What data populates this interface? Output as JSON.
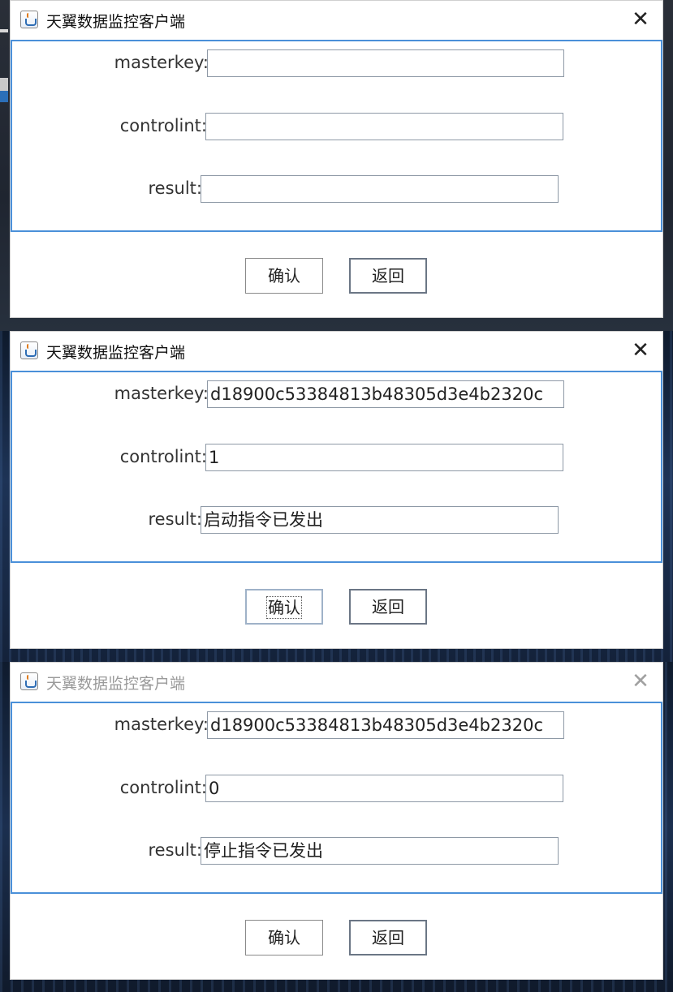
{
  "app": {
    "title": "天翼数据监控客户端"
  },
  "labels": {
    "masterkey": "masterkey:",
    "controlint": "controlint:",
    "result": "result:"
  },
  "buttons": {
    "confirm": "确认",
    "back": "返回"
  },
  "windows": [
    {
      "state": "active",
      "masterkey": "",
      "controlint": "",
      "result": ""
    },
    {
      "state": "active",
      "masterkey": "d18900c53384813b48305d3e4b2320c",
      "controlint": "1",
      "result": "启动指令已发出"
    },
    {
      "state": "inactive",
      "masterkey": "d18900c53384813b48305d3e4b2320c",
      "controlint": "0",
      "result": "停止指令已发出"
    }
  ],
  "icons": {
    "app": "java-cup-icon",
    "close": "close-icon"
  },
  "colors": {
    "panel_border": "#4a90d9",
    "field_border": "#8e99a6",
    "inactive_title": "#9a9a9a"
  }
}
